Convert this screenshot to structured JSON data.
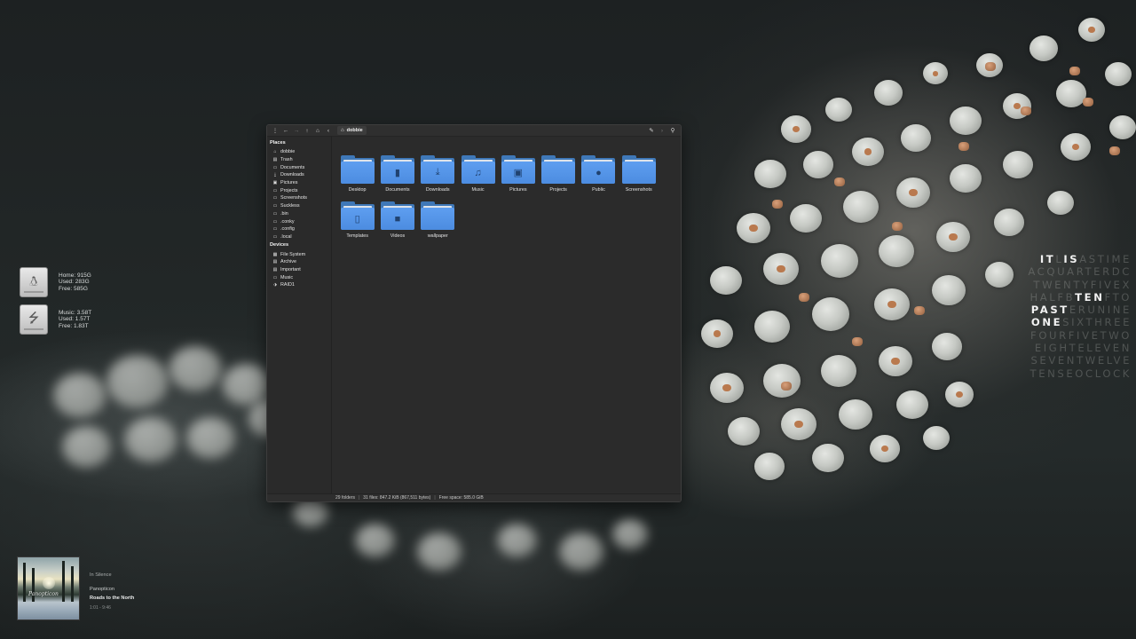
{
  "disks": [
    {
      "icon": "penguin-drive-icon",
      "lines": [
        "Home: 915G",
        "Used: 283G",
        "Free: 585G"
      ]
    },
    {
      "icon": "usb-drive-icon",
      "lines": [
        "Music: 3.58T",
        "Used: 1.57T",
        "Free: 1.83T"
      ]
    }
  ],
  "wordclock": {
    "rows": [
      [
        {
          "t": "IT",
          "on": true
        },
        {
          "t": "L",
          "on": false
        },
        {
          "t": "IS",
          "on": true
        },
        {
          "t": "ASTIME",
          "on": false
        }
      ],
      [
        {
          "t": "ACQUARTERDC",
          "on": false
        }
      ],
      [
        {
          "t": "TWENTYFIVEX",
          "on": false
        }
      ],
      [
        {
          "t": "HALFB",
          "on": false
        },
        {
          "t": "TEN",
          "on": true
        },
        {
          "t": "FTO",
          "on": false
        }
      ],
      [
        {
          "t": "PAST",
          "on": true
        },
        {
          "t": "ERUNINE",
          "on": false
        }
      ],
      [
        {
          "t": "ONE",
          "on": true
        },
        {
          "t": "SIXTHREE",
          "on": false
        }
      ],
      [
        {
          "t": "FOURFIVETWO",
          "on": false
        }
      ],
      [
        {
          "t": "EIGHTELEVEN",
          "on": false
        }
      ],
      [
        {
          "t": "SEVENTWELVE",
          "on": false
        }
      ],
      [
        {
          "t": "TENSEOCLOCK",
          "on": false
        }
      ]
    ]
  },
  "music": {
    "status": "In Silence",
    "artist": "Panopticon",
    "album": "Roads to the North",
    "time": "1:01 - 9:46",
    "cover_text": "Panopticon"
  },
  "window": {
    "toolbar": {
      "menu_icon": "⋮",
      "back_icon": "←",
      "forward_icon": "→",
      "up_icon": "↑",
      "home_icon": "⌂",
      "prev_icon": "‹",
      "location": "dobbie",
      "edit_icon": "✎",
      "next_icon": "›",
      "search_icon": "⚲"
    },
    "sidebar": {
      "places_heading": "Places",
      "places": [
        {
          "label": "dobbie",
          "icon": "⌂"
        },
        {
          "label": "Trash",
          "icon": "▤"
        },
        {
          "label": "Documents",
          "icon": "▭"
        },
        {
          "label": "Downloads",
          "icon": "⤓"
        },
        {
          "label": "Pictures",
          "icon": "▣"
        },
        {
          "label": "Projects",
          "icon": "▭"
        },
        {
          "label": "Screenshots",
          "icon": "▭"
        },
        {
          "label": "Suckless",
          "icon": "▭"
        },
        {
          "label": ".bin",
          "icon": "▭"
        },
        {
          "label": ".conky",
          "icon": "▭"
        },
        {
          "label": ".config",
          "icon": "▭"
        },
        {
          "label": ".local",
          "icon": "▭"
        }
      ],
      "devices_heading": "Devices",
      "devices": [
        {
          "label": "File System",
          "icon": "▦"
        },
        {
          "label": "Archive",
          "icon": "▤"
        },
        {
          "label": "Important",
          "icon": "▤"
        },
        {
          "label": "Music",
          "icon": "▭"
        },
        {
          "label": "RAID1",
          "icon": "⬗"
        }
      ]
    },
    "folders": [
      {
        "label": "Desktop",
        "emblem": ""
      },
      {
        "label": "Documents",
        "emblem": "▮"
      },
      {
        "label": "Downloads",
        "emblem": "⤓"
      },
      {
        "label": "Music",
        "emblem": "♫"
      },
      {
        "label": "Pictures",
        "emblem": "▣"
      },
      {
        "label": "Projects",
        "emblem": ""
      },
      {
        "label": "Public",
        "emblem": "●"
      },
      {
        "label": "Screenshots",
        "emblem": ""
      },
      {
        "label": "Templates",
        "emblem": "▯"
      },
      {
        "label": "Videos",
        "emblem": "■"
      },
      {
        "label": "wallpaper",
        "emblem": ""
      }
    ],
    "status": {
      "folders": "29 folders",
      "files": "31 files: 847.2 KiB (867,511 bytes)",
      "free": "Free space: 585.0 GiB"
    }
  },
  "colors": {
    "folder_blue": "#5e9ef0",
    "window_bg": "#2b2b2b",
    "desktop_bg": "#1b1f20"
  }
}
